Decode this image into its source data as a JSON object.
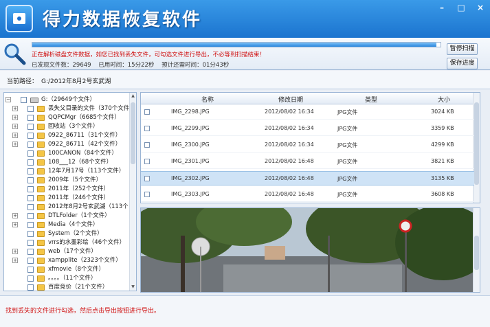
{
  "app": {
    "title": "得力数据恢复软件"
  },
  "window_buttons": [
    "–",
    "□",
    "×"
  ],
  "status": {
    "message": "正在解析磁盘文件数据，如您已找到丢失文件，可勾选文件进行导出，不必等到扫描结束！",
    "progress": 0.99,
    "found_files": "已发现文件数：29649",
    "elapsed": "已用时间：15分22秒",
    "remaining": "预计还需时间：01分43秒",
    "pause_label": "暂停扫描",
    "save_label": "保存进度"
  },
  "path": {
    "label": "当前路径：",
    "value": "G:/2012年8月2号玄武湖"
  },
  "tree": {
    "items": [
      {
        "label": "G:（29649个文件）",
        "kind": "drive",
        "level": 0,
        "expand": "−"
      },
      {
        "label": "丢失父目录的文件（370个文件",
        "kind": "folder",
        "level": 1,
        "expand": "+"
      },
      {
        "label": "QQPCMgr（6685个文件）",
        "kind": "folder",
        "level": 1,
        "expand": "+"
      },
      {
        "label": "回收站（3个文件）",
        "kind": "folder",
        "level": 1,
        "expand": "+"
      },
      {
        "label": "0922_86711（31个文件）",
        "kind": "folder",
        "level": 1,
        "expand": "+"
      },
      {
        "label": "0922_86711（42个文件）",
        "kind": "folder",
        "level": 1,
        "expand": "+"
      },
      {
        "label": "100CANON（84个文件）",
        "kind": "folder",
        "level": 1,
        "expand": ""
      },
      {
        "label": "108___12（68个文件）",
        "kind": "folder",
        "level": 1,
        "expand": ""
      },
      {
        "label": "12年7月17号（113个文件）",
        "kind": "folder",
        "level": 1,
        "expand": ""
      },
      {
        "label": "2009年（5个文件）",
        "kind": "folder",
        "level": 1,
        "expand": ""
      },
      {
        "label": "2011年（252个文件）",
        "kind": "folder",
        "level": 1,
        "expand": ""
      },
      {
        "label": "2011年（246个文件）",
        "kind": "folder",
        "level": 1,
        "expand": ""
      },
      {
        "label": "2012年8月2号玄武湖（113个",
        "kind": "folder",
        "level": 1,
        "expand": ""
      },
      {
        "label": "DTLFolder（1个文件）",
        "kind": "folder",
        "level": 1,
        "expand": "+"
      },
      {
        "label": "Media（4个文件）",
        "kind": "folder",
        "level": 1,
        "expand": "+"
      },
      {
        "label": "System（2个文件）",
        "kind": "folder",
        "level": 1,
        "expand": ""
      },
      {
        "label": "vrrs的水墨彩绘（46个文件）",
        "kind": "folder",
        "level": 1,
        "expand": ""
      },
      {
        "label": "web（17个文件）",
        "kind": "folder",
        "level": 1,
        "expand": "+"
      },
      {
        "label": "xampplite（2323个文件）",
        "kind": "folder",
        "level": 1,
        "expand": "+"
      },
      {
        "label": "xfmovie（8个文件）",
        "kind": "folder",
        "level": 1,
        "expand": ""
      },
      {
        "label": "。。。。（11个文件）",
        "kind": "folder",
        "level": 1,
        "expand": ""
      },
      {
        "label": "百度竞价（21个文件）",
        "kind": "folder",
        "level": 1,
        "expand": ""
      }
    ]
  },
  "files": {
    "headers": {
      "name": "名称",
      "modified": "修改日期",
      "type": "类型",
      "size": "大小"
    },
    "rows": [
      {
        "name": "IMG_2298.JPG",
        "modified": "2012/08/02 16:34",
        "type": "JPG文件",
        "size": "3024 KB",
        "selected": false
      },
      {
        "name": "IMG_2299.JPG",
        "modified": "2012/08/02 16:34",
        "type": "JPG文件",
        "size": "3359 KB",
        "selected": false
      },
      {
        "name": "IMG_2300.JPG",
        "modified": "2012/08/02 16:34",
        "type": "JPG文件",
        "size": "4299 KB",
        "selected": false
      },
      {
        "name": "IMG_2301.JPG",
        "modified": "2012/08/02 16:48",
        "type": "JPG文件",
        "size": "3821 KB",
        "selected": false
      },
      {
        "name": "IMG_2302.JPG",
        "modified": "2012/08/02 16:48",
        "type": "JPG文件",
        "size": "3135 KB",
        "selected": true
      },
      {
        "name": "IMG_2303.JPG",
        "modified": "2012/08/02 16:48",
        "type": "JPG文件",
        "size": "3608 KB",
        "selected": false
      }
    ]
  },
  "footer": {
    "hint": "找到丢失的文件进行勾选，然后点击导出按钮进行导出。"
  },
  "colors": {
    "title_bar": "#1b74cf",
    "accent_red": "#d01010",
    "selection": "#cfe3f6"
  }
}
